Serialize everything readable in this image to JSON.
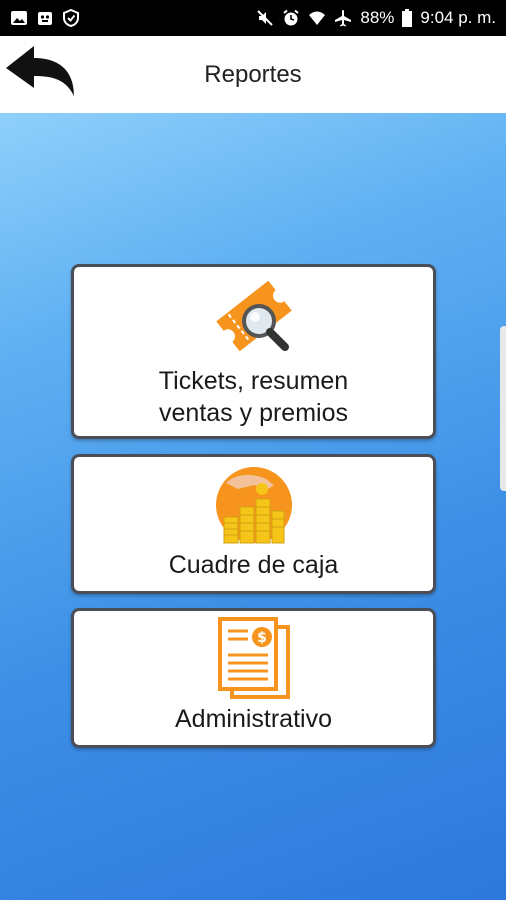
{
  "status_bar": {
    "battery": "88%",
    "time": "9:04 p. m.",
    "icons": [
      "image-icon",
      "bot-icon",
      "shield-icon",
      "mute-icon",
      "alarm-icon",
      "wifi-icon",
      "airplane-icon",
      "battery-icon"
    ]
  },
  "header": {
    "title": "Reportes",
    "back_icon": "back-arrow-icon"
  },
  "menu": [
    {
      "label": "Tickets, resumen ventas y premios",
      "icon": "ticket-search-icon"
    },
    {
      "label": "Cuadre de caja",
      "icon": "coins-hand-icon"
    },
    {
      "label": "Administrativo",
      "icon": "documents-money-icon"
    }
  ],
  "colors": {
    "accent": "#f7941d",
    "gradient_top": "#8fd0fb",
    "gradient_bottom": "#2d78dc",
    "card_border": "#4a4f57"
  }
}
